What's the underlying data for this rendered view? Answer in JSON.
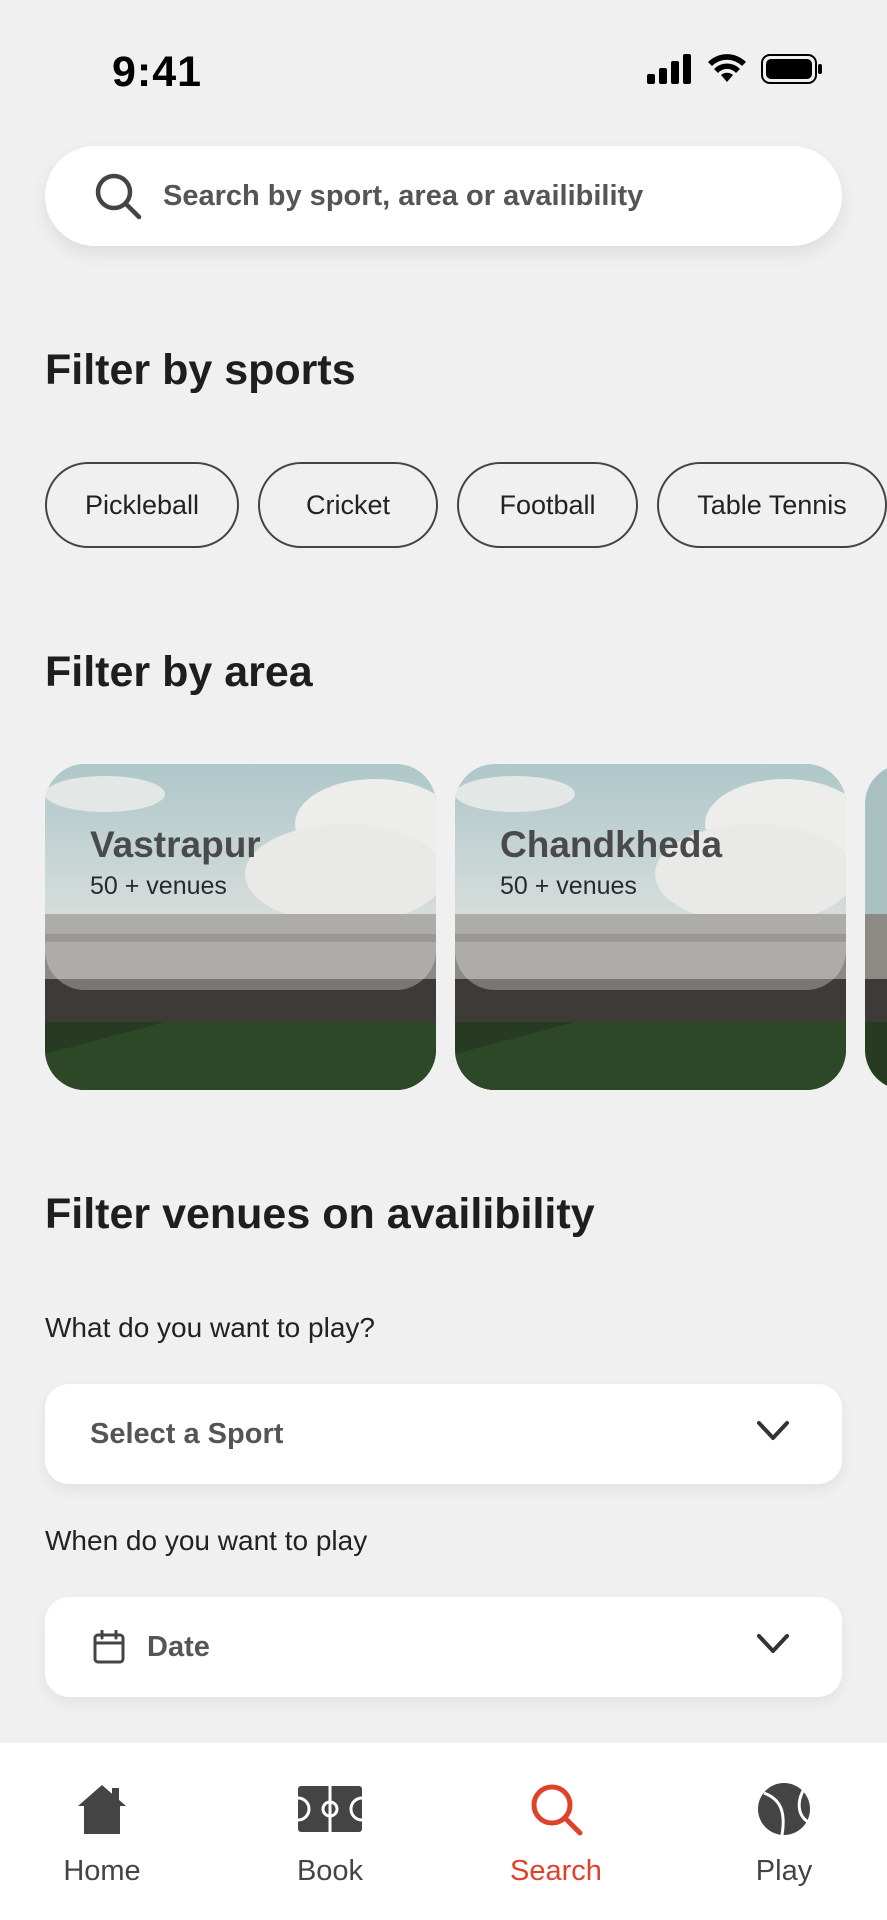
{
  "status": {
    "time": "9:41"
  },
  "search": {
    "placeholder": "Search by sport, area or availibility"
  },
  "sports": {
    "title": "Filter by sports",
    "chips": [
      "Pickleball",
      "Cricket",
      "Football",
      "Table Tennis"
    ]
  },
  "areas": {
    "title": "Filter by area",
    "cards": [
      {
        "name": "Vastrapur",
        "count": "50 + venues"
      },
      {
        "name": "Chandkheda",
        "count": "50 + venues"
      }
    ]
  },
  "availability": {
    "title": "Filter venues on availibility",
    "sport_label": "What do you want to play?",
    "sport_value": "Select a Sport",
    "time_label": "When do you want to play",
    "date_value": "Date"
  },
  "tabbar": {
    "items": [
      {
        "label": "Home",
        "icon": "home-icon"
      },
      {
        "label": "Book",
        "icon": "court-icon"
      },
      {
        "label": "Search",
        "icon": "search-icon",
        "active": true
      },
      {
        "label": "Play",
        "icon": "ball-icon"
      }
    ]
  },
  "colors": {
    "accent": "#e0412b",
    "background": "#f0f0f0",
    "card": "#ffffff"
  }
}
